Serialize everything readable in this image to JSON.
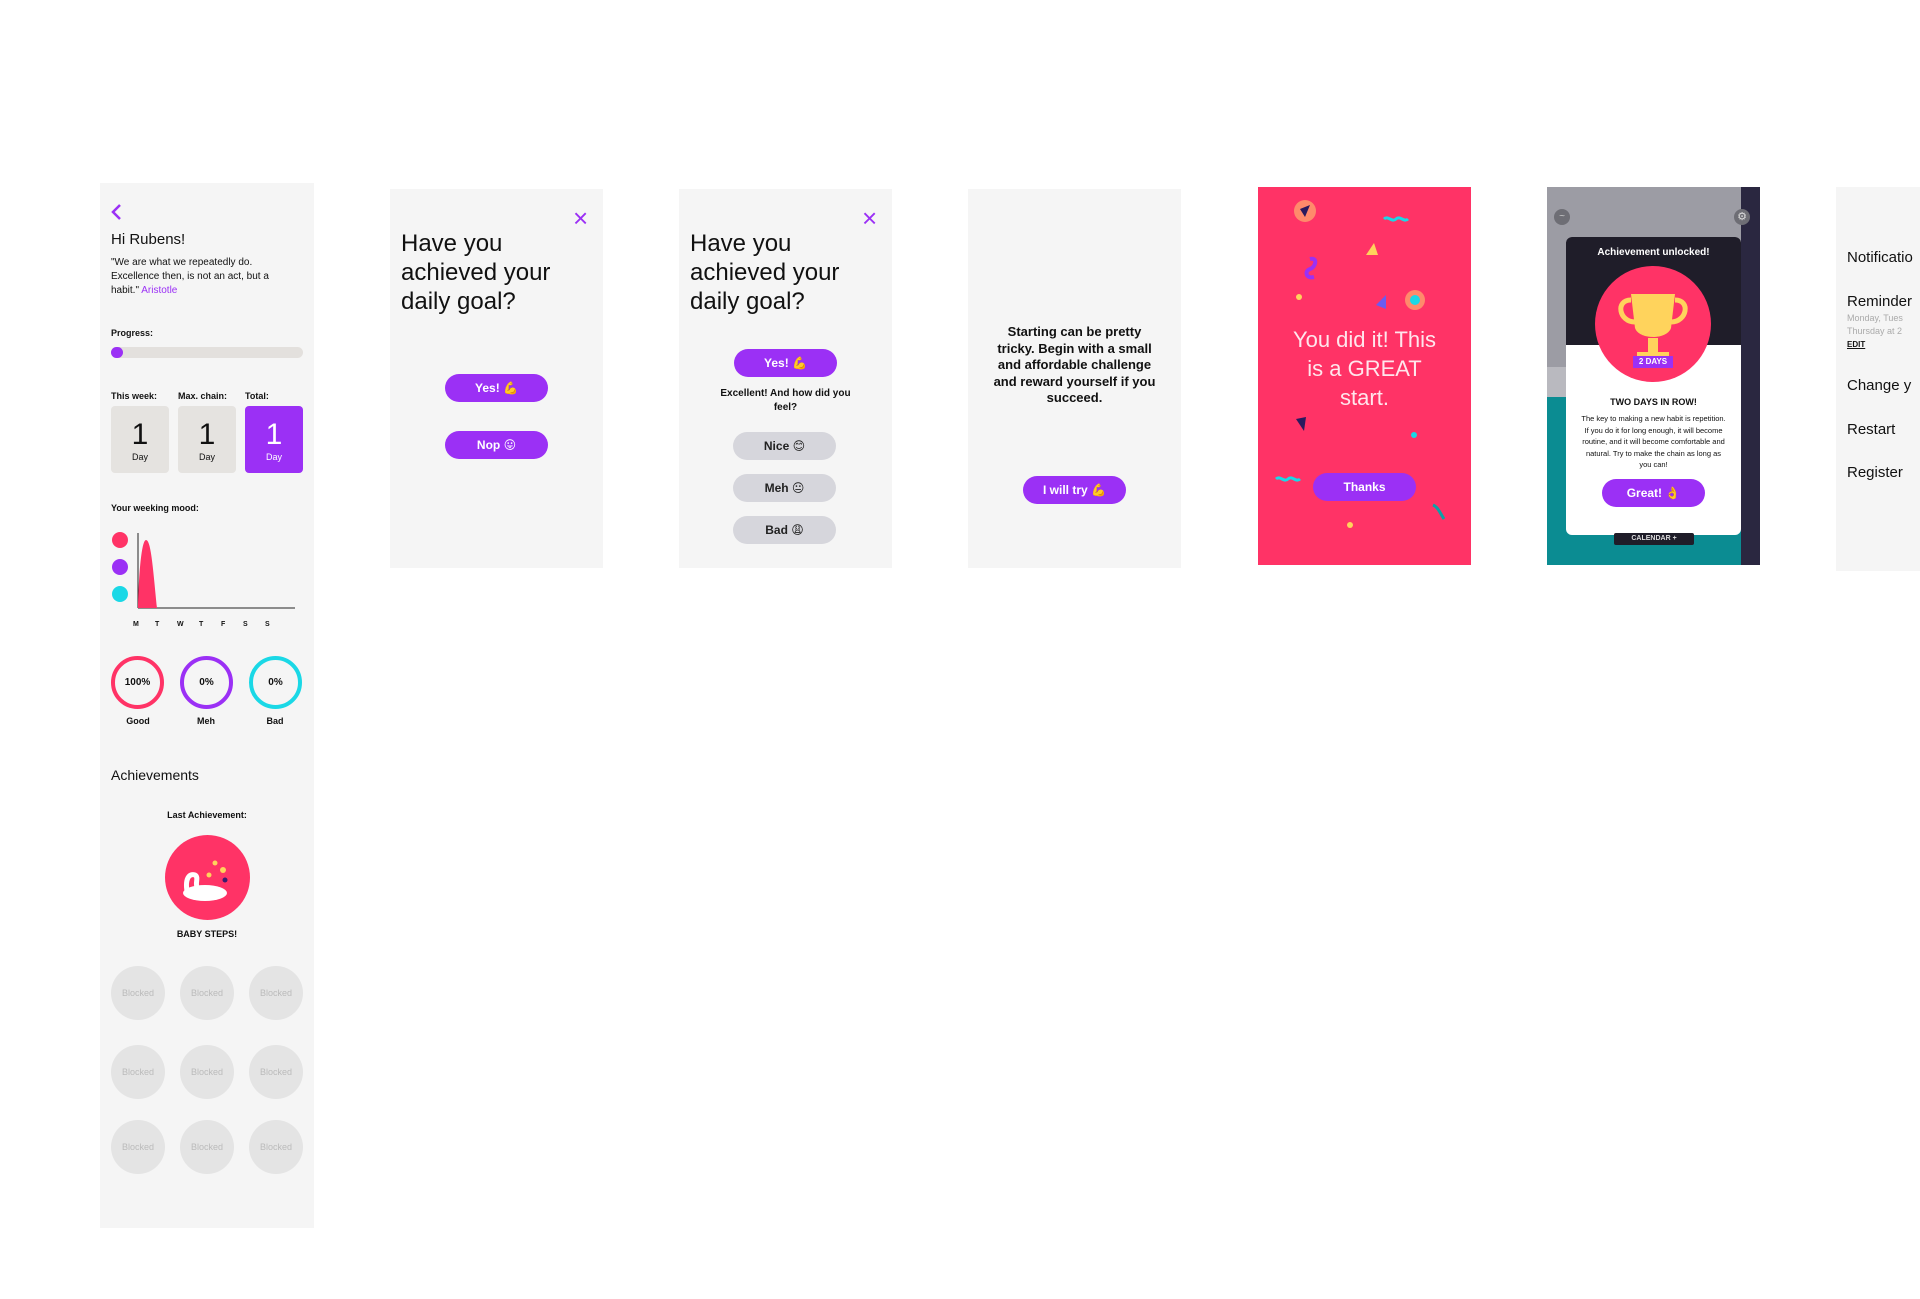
{
  "colors": {
    "purple": "#9b30f5",
    "pink": "#ff3366",
    "cyan": "#1ad8e6",
    "teal": "#0aa2a8",
    "panel": "#f5f5f5"
  },
  "profile": {
    "back_icon": "chevron-left-icon",
    "greeting": "Hi Rubens!",
    "quote": "\"We are what we repeatedly do. Excellence then, is not an act, but a habit.\"",
    "quote_author": "Aristotle",
    "progress_label": "Progress:",
    "progress_fraction": 0.05,
    "stats": [
      {
        "label": "This week:",
        "value": "1",
        "unit": "Day",
        "highlight": false
      },
      {
        "label": "Max. chain:",
        "value": "1",
        "unit": "Day",
        "highlight": false
      },
      {
        "label": "Total:",
        "value": "1",
        "unit": "Day",
        "highlight": true
      }
    ],
    "mood_title": "Your weeking mood:",
    "mood_days": [
      "M",
      "T",
      "W",
      "T",
      "F",
      "S",
      "S"
    ],
    "mood_rings": [
      {
        "value": "100%",
        "label": "Good",
        "color": "#ff3366"
      },
      {
        "value": "0%",
        "label": "Meh",
        "color": "#9b30f5"
      },
      {
        "value": "0%",
        "label": "Bad",
        "color": "#1ad8e6"
      }
    ],
    "achievements_title": "Achievements",
    "last_achievement_label": "Last Achievement:",
    "last_achievement_name": "BABY STEPS!",
    "blocked_label": "Blocked"
  },
  "goal1": {
    "title": "Have you achieved your daily goal?",
    "yes": "Yes! 💪",
    "no": "Nop 😛",
    "close_icon": "close-icon"
  },
  "goal2": {
    "title": "Have you achieved your daily goal?",
    "yes": "Yes! 💪",
    "feedback": "Excellent! And how did you feel?",
    "options": [
      "Nice 😊",
      "Meh 😐",
      "Bad 😩"
    ],
    "close_icon": "close-icon"
  },
  "tip": {
    "text": "Starting can be pretty tricky. Begin with a small and affordable challenge and reward yourself if you succeed.",
    "button": "I will try 💪"
  },
  "celebrate": {
    "text": "You did it! This is a GREAT start.",
    "button": "Thanks"
  },
  "achievement": {
    "header": "Achievement unlocked!",
    "badge": "2 DAYS",
    "title": "TWO DAYS IN ROW!",
    "body": "The key to making a new habit is repetition. If you do it for long enough, it will become routine, and it will become comfortable and natural. Try to make the chain as long as you can!",
    "button": "Great! 👌",
    "calendar": "CALENDAR +"
  },
  "settings": {
    "items": [
      {
        "label": "Notificatio"
      },
      {
        "label": "Reminder",
        "sub1": "Monday, Tues",
        "sub2": "Thursday at 2",
        "edit": "EDIT"
      },
      {
        "label": "Change y"
      },
      {
        "label": "Restart"
      },
      {
        "label": "Register"
      }
    ]
  }
}
